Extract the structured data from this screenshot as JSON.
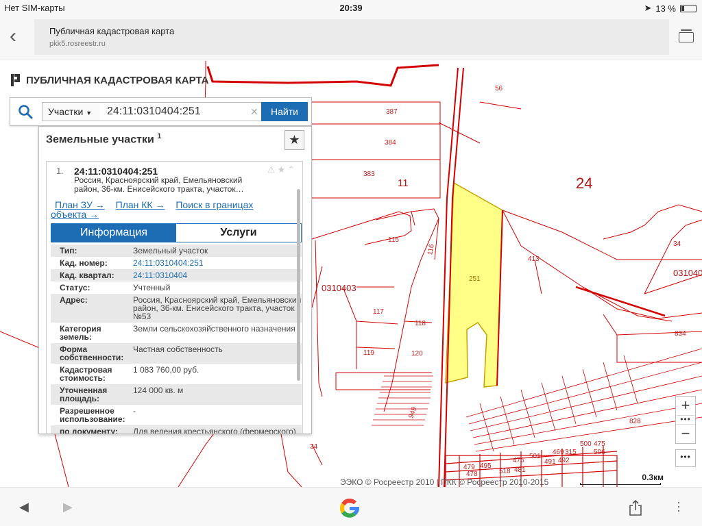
{
  "status_bar": {
    "carrier": "Нет SIM-карты",
    "time": "20:39",
    "battery": "13 %"
  },
  "browser": {
    "page_title": "Публичная кадастровая карта",
    "host": "pkk5.rosreestr.ru"
  },
  "app": {
    "title": "ПУБЛИЧНАЯ КАДАСТРОВАЯ КАРТА"
  },
  "search": {
    "type_label": "Участки",
    "query": "24:11:0310404:251",
    "button_label": "Найти"
  },
  "panel": {
    "title": "Земельные участки",
    "count": "1",
    "result": {
      "number": "1.",
      "cad_id": "24:11:0310404:251",
      "address_short": "Россия, Красноярский край, Емельяновский район, 36-км. Енисейского тракта, участок…",
      "links": [
        "План ЗУ →",
        "План КК →",
        "Поиск в границах объекта →"
      ],
      "tabs": [
        "Информация",
        "Услуги"
      ],
      "properties": [
        {
          "key": "Тип:",
          "value": "Земельный участок"
        },
        {
          "key": "Кад. номер:",
          "value": "24:11:0310404:251"
        },
        {
          "key": "Кад. квартал:",
          "value": "24:11:0310404"
        },
        {
          "key": "Статус:",
          "value": "Учтенный"
        },
        {
          "key": "Адрес:",
          "value": "Россия, Красноярский край, Емельяновский район, 36-км. Енисейского тракта, участок №53"
        },
        {
          "key": "Категория земель:",
          "value": "Земли сельскохозяйственного назначения"
        },
        {
          "key": "Форма собственности:",
          "value": "Частная собственность"
        },
        {
          "key": "Кадастровая стоимость:",
          "value": "1 083 760,00 руб."
        },
        {
          "key": "Уточненная площадь:",
          "value": "124 000 кв. м"
        },
        {
          "key": "Разрешенное использование:",
          "value": "-"
        },
        {
          "key": "по документу:",
          "value": "Для ведения крестьянского (фермерского) хозяйства"
        }
      ]
    }
  },
  "map": {
    "parcel_labels": [
      "56",
      "387",
      "384",
      "383",
      "115",
      "116",
      "117",
      "118",
      "119",
      "120",
      "251",
      "413",
      "34",
      "834",
      "828",
      "34",
      "949"
    ],
    "dense_labels": [
      "501",
      "476",
      "469",
      "315",
      "500",
      "475",
      "506",
      "479",
      "495",
      "491",
      "492",
      "478",
      "518",
      "481"
    ],
    "district_labels": [
      "24",
      "11"
    ],
    "quarter_labels": [
      "0310403",
      "031040"
    ],
    "attribution": "ЭЭКО © Росреестр 2010 | ПКК © Росреестр 2010-2015",
    "scale": "0.3км",
    "highlight_color": "#ffff88",
    "boundary_color": "#d40000"
  },
  "zoom": {
    "plus": "+",
    "minus": "−"
  }
}
